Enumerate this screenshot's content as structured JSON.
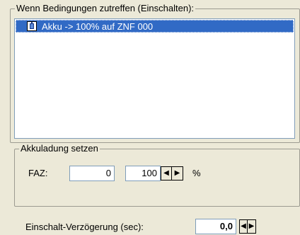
{
  "conditions_group": {
    "title": "Wenn Bedingungen zutreffen (Einschalten):",
    "items": [
      {
        "label": "Akku -> 100% auf ZNF 000",
        "icon": "battery-icon",
        "selected": true
      }
    ]
  },
  "charge_group": {
    "title": "Akkuladung setzen",
    "faz_label": "FAZ:",
    "faz_value": "0",
    "percent_value": "100",
    "percent_unit": "%"
  },
  "delay": {
    "label": "Einschalt-Verzögerung (sec):",
    "value": "0,0"
  },
  "colors": {
    "selection": "#316ac5",
    "window": "#ece9d8"
  }
}
